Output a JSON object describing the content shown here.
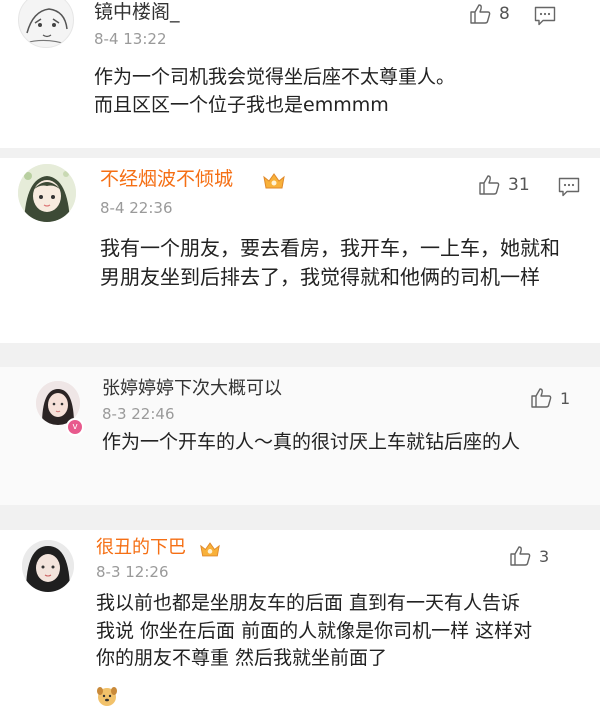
{
  "comments": [
    {
      "username": "镜中楼阁_",
      "time": "8-4 13:22",
      "likes": "8",
      "text": "作为一个司机我会觉得坐后座不太尊重人。而且区区一个位子我也是emmmm"
    },
    {
      "username": "不经烟波不倾城",
      "time": "8-4 22:36",
      "likes": "31",
      "text": "我有一个朋友，要去看房，我开车，一上车，她就和男朋友坐到后排去了，我觉得就和他俩的司机一样"
    },
    {
      "username": "张婷婷婷下次大概可以",
      "time": "8-3 22:46",
      "likes": "1",
      "text": "作为一个开车的人～真的很讨厌上车就钻后座的人"
    },
    {
      "username": "很丑的下巴",
      "time": "8-3 12:26",
      "likes": "3",
      "text": "我以前也都是坐朋友车的后面 直到有一天有人告诉我说 你坐在后面 前面的人就像是你司机一样 这样对你的朋友不尊重 然后我就坐前面了"
    }
  ],
  "colors": {
    "vip_name": "#f56f14",
    "separator": "#f1f1f1",
    "time": "#9a9a9a"
  },
  "icons": [
    "thumbs-up-icon",
    "comment-bubble-icon",
    "vip-crown-icon",
    "verified-badge-icon",
    "dog-emoji-icon"
  ]
}
